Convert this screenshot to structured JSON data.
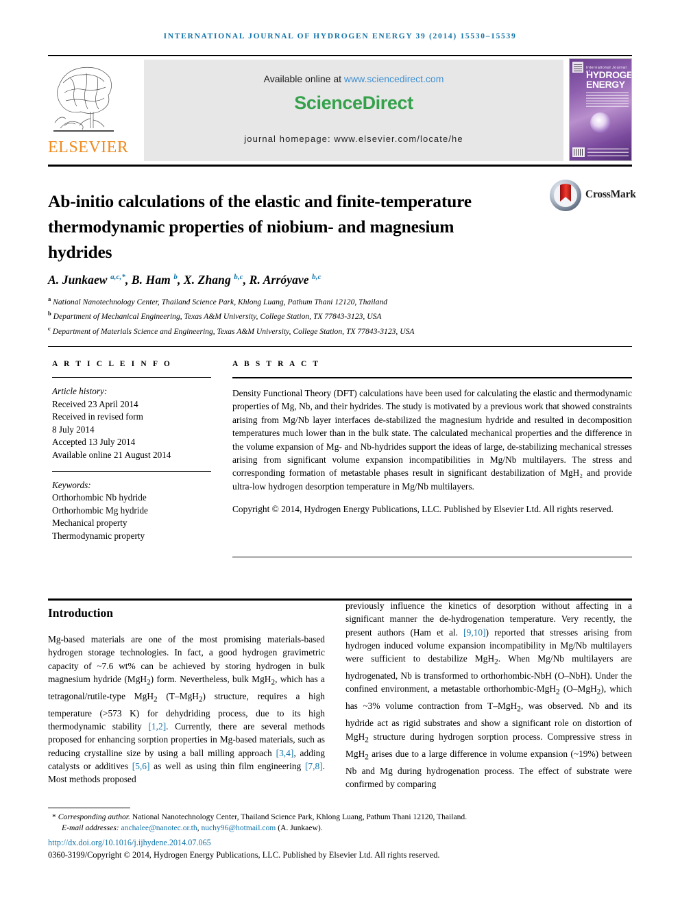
{
  "running_head": "International Journal of Hydrogen Energy 39 (2014) 15530–15539",
  "masthead": {
    "publisher_name": "ELSEVIER",
    "available_prefix": "Available online at ",
    "available_url": "www.sciencedirect.com",
    "sciencedirect_logo": "ScienceDirect",
    "journal_homepage": "journal homepage: www.elsevier.com/locate/he",
    "cover": {
      "line1": "International Journal of",
      "line2": "HYDROGEN",
      "line3": "ENERGY"
    }
  },
  "crossmark": {
    "label": "CrossMark"
  },
  "article": {
    "title": "Ab-initio calculations of the elastic and finite-temperature thermodynamic properties of niobium- and magnesium hydrides",
    "authors_html": "A. Junkaew <sup>a,c,*</sup>, B. Ham <sup>b</sup>, X. Zhang <sup>b,c</sup>, R. Arróyave <sup>b,c</sup>",
    "affiliations": [
      {
        "marker": "a",
        "text": "National Nanotechnology Center, Thailand Science Park, Khlong Luang, Pathum Thani 12120, Thailand"
      },
      {
        "marker": "b",
        "text": "Department of Mechanical Engineering, Texas A&M University, College Station, TX 77843-3123, USA"
      },
      {
        "marker": "c",
        "text": "Department of Materials Science and Engineering, Texas A&M University, College Station, TX 77843-3123, USA"
      }
    ]
  },
  "article_info": {
    "section_label": "A R T I C L E   I N F O",
    "history_label": "Article history:",
    "history": [
      "Received 23 April 2014",
      "Received in revised form",
      "8 July 2014",
      "Accepted 13 July 2014",
      "Available online 21 August 2014"
    ],
    "keywords_label": "Keywords:",
    "keywords": [
      "Orthorhombic Nb hydride",
      "Orthorhombic Mg hydride",
      "Mechanical property",
      "Thermodynamic property"
    ]
  },
  "abstract": {
    "section_label": "A B S T R A C T",
    "body": "Density Functional Theory (DFT) calculations have been used for calculating the elastic and thermodynamic properties of Mg, Nb, and their hydrides. The study is motivated by a previous work that showed constraints arising from Mg/Nb layer interfaces de-stabilized the magnesium hydride and resulted in decomposition temperatures much lower than in the bulk state. The calculated mechanical properties and the difference in the volume expansion of Mg- and Nb-hydrides support the ideas of large, de-stabilizing mechanical stresses arising from significant volume expansion incompatibilities in Mg/Nb multilayers. The stress and corresponding formation of metastable phases result in significant destabilization of MgH₂ and provide ultra-low hydrogen desorption temperature in Mg/Nb multilayers.",
    "copyright": "Copyright © 2014, Hydrogen Energy Publications, LLC. Published by Elsevier Ltd. All rights reserved."
  },
  "body": {
    "intro_heading": "Introduction",
    "left_paragraph_html": "Mg-based materials are one of the most promising materials-based hydrogen storage technologies. In fact, a good hydrogen gravimetric capacity of ~7.6 wt% can be achieved by storing hydrogen in bulk magnesium hydride (MgH<sub>2</sub>) form. Nevertheless, bulk MgH<sub>2</sub>, which has a tetragonal/rutile-type MgH<sub>2</sub> (T&ndash;MgH<sub>2</sub>) structure, requires a high temperature (&gt;573 K) for dehydriding process, due to its high thermodynamic stability <span class=\"ref\">[1,2]</span>. Currently, there are several methods proposed for enhancing sorption properties in Mg-based materials, such as reducing crystalline size by using a ball milling approach <span class=\"ref\">[3,4]</span>, adding catalysts or additives <span class=\"ref\">[5,6]</span> as well as using thin film engineering <span class=\"ref\">[7,8]</span>. Most methods proposed",
    "right_paragraph_html": "previously influence the kinetics of desorption without affecting in a significant manner the de-hydrogenation temperature. Very recently, the present authors (Ham et al. <span class=\"ref\">[9,10]</span>) reported that stresses arising from hydrogen induced volume expansion incompatibility in Mg/Nb multilayers were sufficient to destabilize MgH<sub>2</sub>. When Mg/Nb multilayers are hydrogenated, Nb is transformed to orthorhombic-NbH (O&ndash;NbH). Under the confined environment, a metastable orthorhombic-MgH<sub>2</sub> (O&ndash;MgH<sub>2</sub>), which has ~3% volume contraction from T&ndash;MgH<sub>2</sub>, was observed. Nb and its hydride act as rigid substrates and show a significant role on distortion of MgH<sub>2</sub> structure during hydrogen sorption process. Compressive stress in MgH<sub>2</sub> arises due to a large difference in volume expansion (~19%) between Nb and Mg during hydrogenation process. The effect of substrate were confirmed by comparing"
  },
  "footer": {
    "corresponding_marker": "*",
    "corresponding_label": "Corresponding author.",
    "corresponding_address": " National Nanotechnology Center, Thailand Science Park, Khlong Luang, Pathum Thani 12120, Thailand.",
    "email_label": "E-mail addresses:",
    "email1": "anchalee@nanotec.or.th",
    "email2": "nuchy96@hotmail.com",
    "email_suffix": "(A. Junkaew).",
    "doi": "http://dx.doi.org/10.1016/j.ijhydene.2014.07.065",
    "issn_line": "0360-3199/Copyright © 2014, Hydrogen Energy Publications, LLC. Published by Elsevier Ltd. All rights reserved."
  },
  "colors": {
    "link_blue": "#1273a8",
    "sciencedirect_green": "#34a14b",
    "elsevier_orange": "#f08a1c"
  }
}
